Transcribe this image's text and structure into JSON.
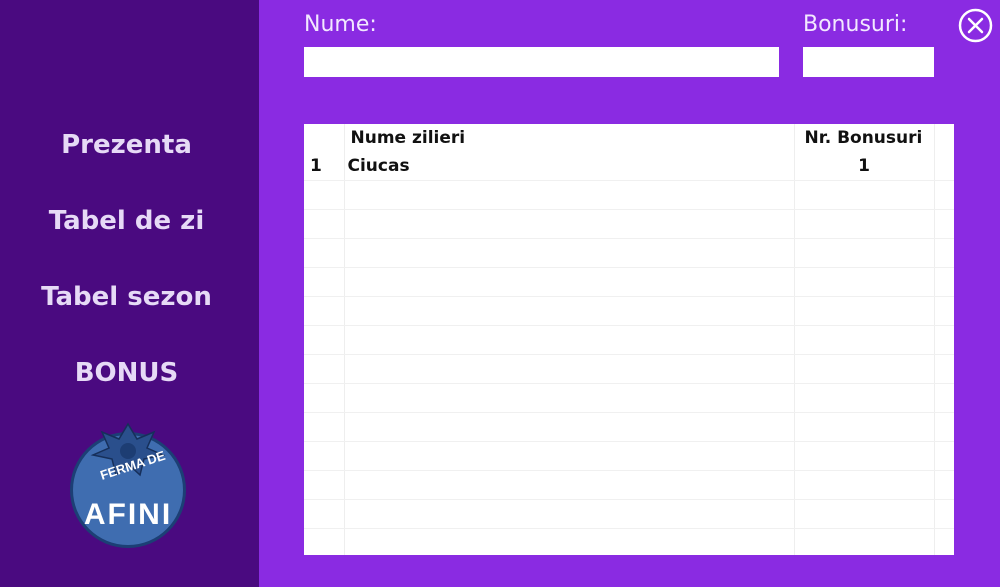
{
  "sidebar": {
    "items": [
      {
        "label": "Prezenta"
      },
      {
        "label": "Tabel de zi"
      },
      {
        "label": "Tabel sezon"
      },
      {
        "label": "BONUS"
      }
    ],
    "logo": {
      "top_text": "FERMA DE",
      "main_text": "AFINI"
    }
  },
  "form": {
    "name_label": "Nume:",
    "name_value": "",
    "bonus_label": "Bonusuri:",
    "bonus_value": ""
  },
  "table": {
    "columns": [
      "",
      "Nume zilieri",
      "Nr. Bonusuri"
    ],
    "rows": [
      {
        "index": "1",
        "name": "Ciucas",
        "bonus": "1"
      }
    ],
    "empty_rows": 13
  },
  "colors": {
    "background": "#8a2be2",
    "sidebar": "#4a0a80",
    "sidebar_text": "#e6daf6",
    "logo_blue": "#3f6db0"
  },
  "icons": {
    "close": "close-circle-icon",
    "logo": "blueberry-logo-icon"
  }
}
